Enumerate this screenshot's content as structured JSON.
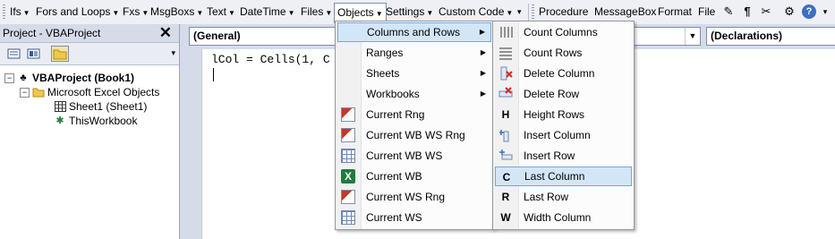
{
  "toolbar": {
    "menus": [
      {
        "label": "Ifs"
      },
      {
        "label": "Fors and Loops"
      },
      {
        "label": "Fxs"
      },
      {
        "label": "MsgBoxs"
      },
      {
        "label": "Text"
      },
      {
        "label": "DateTime"
      },
      {
        "label": "Files"
      },
      {
        "label": "Objects"
      },
      {
        "label": "Settings"
      },
      {
        "label": "Custom Code"
      }
    ],
    "commands": [
      {
        "label": "Procedure"
      },
      {
        "label": "MessageBox"
      },
      {
        "label": "Format"
      },
      {
        "label": "File"
      }
    ],
    "icons": [
      "edit-icon",
      "paragraph-icon",
      "tools-icon",
      "help-icon"
    ]
  },
  "project": {
    "title": "Project - VBAProject",
    "tree": [
      {
        "label": "VBAProject (Book1)"
      },
      {
        "label": "Microsoft Excel Objects"
      },
      {
        "label": "Sheet1 (Sheet1)"
      },
      {
        "label": "ThisWorkbook"
      }
    ]
  },
  "editor": {
    "object_combo": "(General)",
    "proc_combo": "(Declarations)",
    "code_line": "lCol = Cells(1, C"
  },
  "objects_menu": [
    {
      "label": "Columns and Rows",
      "icon": "none",
      "submenu": true
    },
    {
      "label": "Ranges",
      "icon": "none",
      "submenu": true
    },
    {
      "label": "Sheets",
      "icon": "none",
      "submenu": true
    },
    {
      "label": "Workbooks",
      "icon": "none",
      "submenu": true
    },
    {
      "label": "Current Rng",
      "icon": "range-icon"
    },
    {
      "label": "Current WB WS Rng",
      "icon": "range-icon"
    },
    {
      "label": "Current WB WS",
      "icon": "grid-icon"
    },
    {
      "label": "Current WB",
      "icon": "excel-icon"
    },
    {
      "label": "Current WS Rng",
      "icon": "range-icon"
    },
    {
      "label": "Current WS",
      "icon": "grid-icon"
    }
  ],
  "columns_rows_menu": [
    {
      "label": "Count Columns",
      "glyph": ""
    },
    {
      "label": "Count Rows",
      "glyph": ""
    },
    {
      "label": "Delete Column",
      "glyph": ""
    },
    {
      "label": "Delete Row",
      "glyph": ""
    },
    {
      "label": "Height Rows",
      "glyph": "H"
    },
    {
      "label": "Insert Column",
      "glyph": ""
    },
    {
      "label": "Insert Row",
      "glyph": ""
    },
    {
      "label": "Last Column",
      "glyph": "C"
    },
    {
      "label": "Last Row",
      "glyph": "R"
    },
    {
      "label": "Width Column",
      "glyph": "W"
    }
  ],
  "colors": {
    "highlight": "#d3e6f7",
    "highlight_border": "#74a9dc",
    "toolbar_bg": "#eef0f5"
  }
}
